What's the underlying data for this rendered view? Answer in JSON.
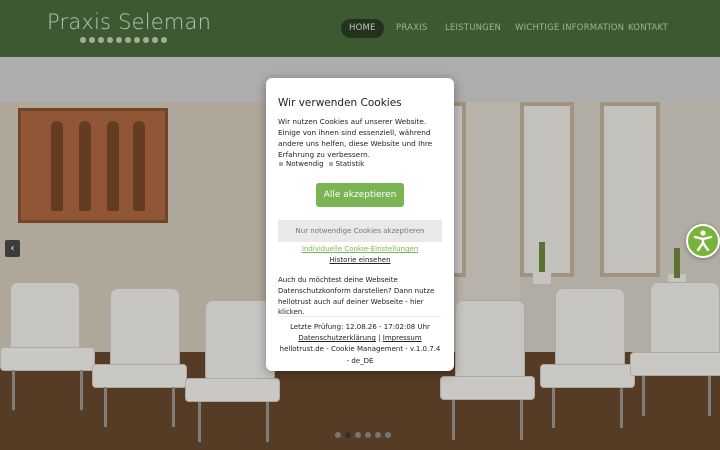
{
  "header": {
    "logo_text": "Praxis Seleman",
    "nav": [
      {
        "label": "HOME",
        "active": true
      },
      {
        "label": "PRAXIS",
        "active": false
      },
      {
        "label": "LEISTUNGEN",
        "active": false
      },
      {
        "label": "WICHTIGE INFORMATION",
        "active": false
      },
      {
        "label": "KONTAKT",
        "active": false
      }
    ]
  },
  "slider": {
    "prev_arrow": "‹",
    "dot_count": 6,
    "active_dot": 1
  },
  "accessibility_button": {
    "icon": "accessibility-icon",
    "color": "#78b43c"
  },
  "cookie_modal": {
    "title": "Wir verwenden Cookies",
    "body": "Wir nutzen Cookies auf unserer Website. Einige von ihnen sind essenziell, während andere uns helfen, diese Website und Ihre Erfahrung zu verbessern.",
    "options": [
      "Notwendig",
      "Statistik"
    ],
    "accept_all_label": "Alle akzeptieren",
    "necessary_only_label": "Nur notwendige Cookies akzeptieren",
    "individual_settings_link": "Individuelle Cookie-Einstellungen",
    "history_link": "Historie einsehen",
    "promo_text": "Auch du möchtest deine Webseite Datenschutzkonform darstellen? Dann nutze hellotrust auch auf deiner Webseite - hier klicken.",
    "last_check": "Letzte Prüfung: 12.08.26 - 17:02:08 Uhr",
    "privacy_link": "Datenschutzerklärung",
    "separator": "|",
    "imprint_link": "Impressum",
    "version": "hellotrust.de - Cookie Management - v.1.0.7.4 - de_DE"
  },
  "colors": {
    "header_bg": "#4a6d3e",
    "accent_green": "#7ab453",
    "subbar_bg": "#d3d3d3"
  }
}
